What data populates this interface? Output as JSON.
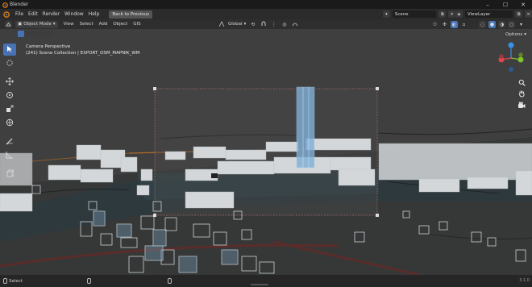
{
  "window": {
    "title": "Blender"
  },
  "menu": {
    "items": [
      "File",
      "Edit",
      "Render",
      "Window",
      "Help"
    ],
    "back_button": "Back to Previous"
  },
  "scene": {
    "value": "Scene"
  },
  "view_layer": {
    "value": "ViewLayer"
  },
  "viewport_header": {
    "mode": "Object Mode",
    "items": [
      "View",
      "Select",
      "Add",
      "Object",
      "GIS"
    ],
    "orientation": "Global",
    "options": "Options"
  },
  "viewport_info": {
    "line1": "Camera Perspective",
    "line2": "(241) Scene Collection | EXPORT_OSM_MAPNIK_WM"
  },
  "gizmo": {
    "x": "X",
    "y": "Y",
    "z": "Z"
  },
  "status": {
    "select": "Select",
    "version": "3.1.0"
  },
  "icons": {
    "tools": [
      "cursor-select-icon",
      "cursor-3d-icon",
      "move-icon",
      "rotate-icon",
      "scale-icon",
      "transform-icon",
      "annotate-icon",
      "measure-icon",
      "add-cube-icon"
    ],
    "nav": [
      "zoom-icon",
      "hand-pan-icon",
      "camera-view-icon"
    ]
  },
  "colors": {
    "accent": "#4772b3",
    "viewport_bg": "#3f3f3f",
    "axis_x": "#e0454f",
    "axis_y": "#7fc22a",
    "axis_z": "#3a8fe6"
  }
}
